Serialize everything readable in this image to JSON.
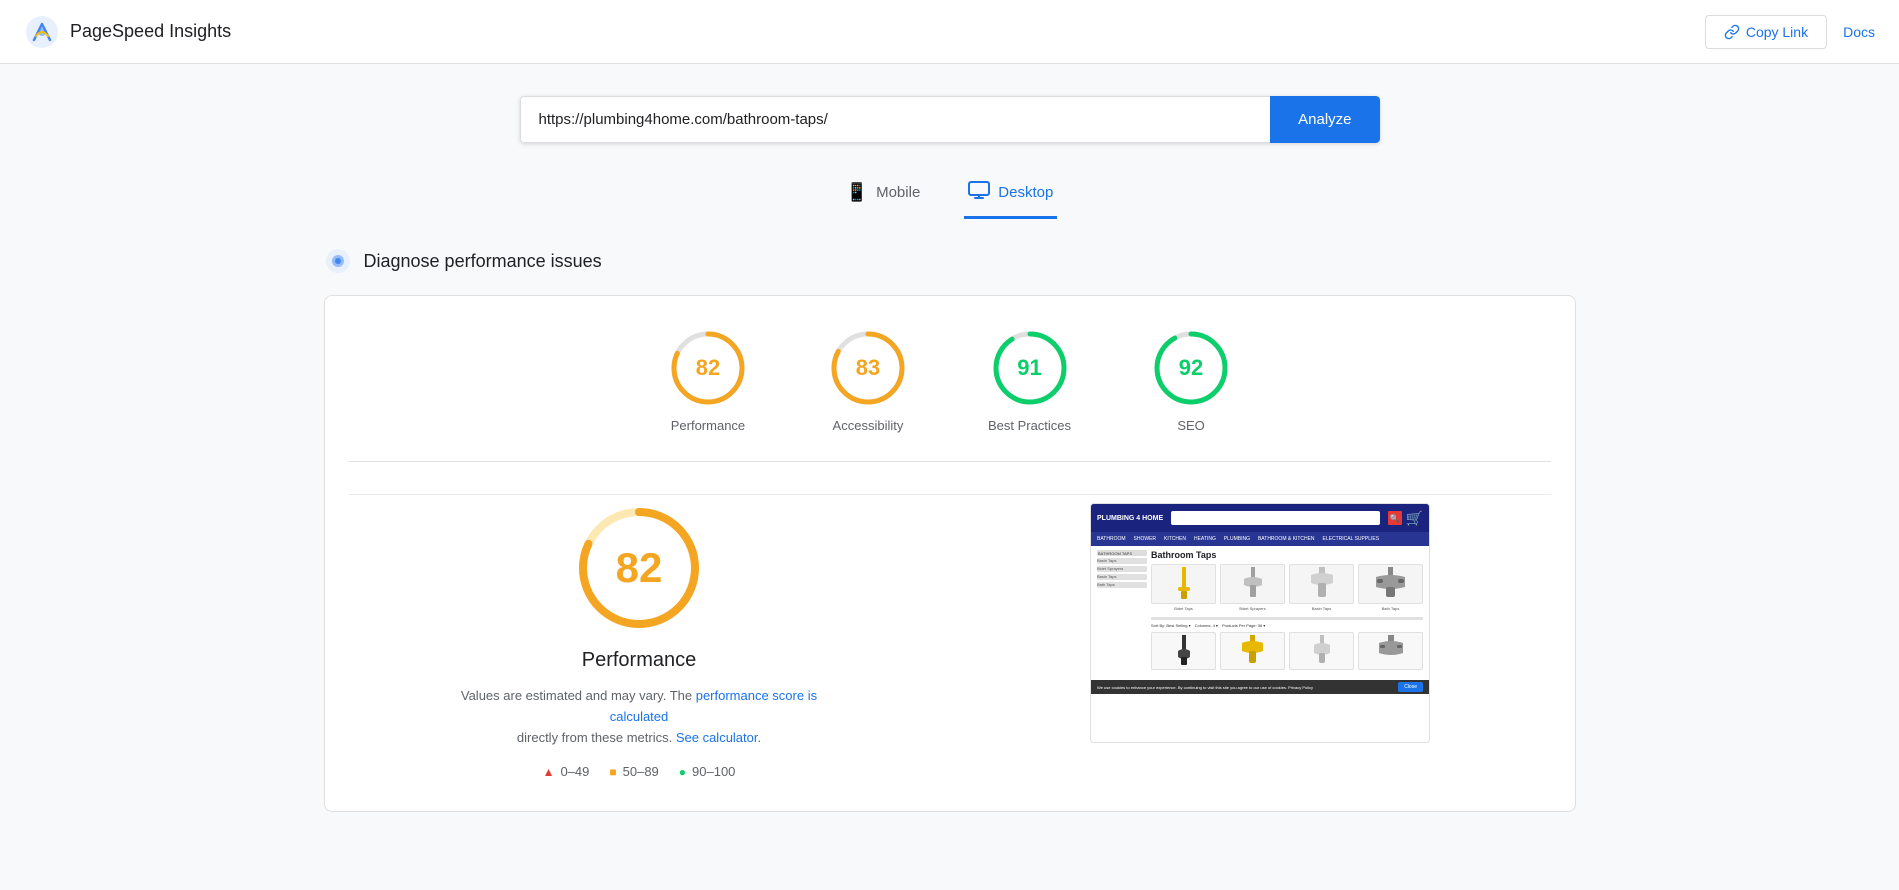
{
  "header": {
    "app_name": "PageSpeed Insights",
    "copy_link_label": "Copy Link",
    "docs_label": "Docs"
  },
  "url_bar": {
    "url_value": "https://plumbing4home.com/bathroom-taps/",
    "analyze_label": "Analyze"
  },
  "tabs": [
    {
      "id": "mobile",
      "label": "Mobile",
      "active": false
    },
    {
      "id": "desktop",
      "label": "Desktop",
      "active": true
    }
  ],
  "section": {
    "title": "Diagnose performance issues"
  },
  "scores": [
    {
      "id": "performance",
      "value": 82,
      "label": "Performance",
      "color": "#f4a522",
      "bg_color": "#fce8b2",
      "pct": 82
    },
    {
      "id": "accessibility",
      "value": 83,
      "label": "Accessibility",
      "color": "#f4a522",
      "bg_color": "#fce8b2",
      "pct": 83
    },
    {
      "id": "best-practices",
      "value": 91,
      "label": "Best Practices",
      "color": "#0cce6b",
      "bg_color": "#c8f5d5",
      "pct": 91
    },
    {
      "id": "seo",
      "value": 92,
      "label": "SEO",
      "color": "#0cce6b",
      "bg_color": "#c8f5d5",
      "pct": 92
    }
  ],
  "detail": {
    "big_score": 82,
    "big_label": "Performance",
    "metrics_note_text": "Values are estimated and may vary. The",
    "metrics_note_link1": "performance score is calculated",
    "metrics_note_mid": "directly from these metrics.",
    "metrics_note_link2": "See calculator.",
    "legend": [
      {
        "icon": "▲",
        "color": "#e53935",
        "range": "0–49"
      },
      {
        "icon": "■",
        "color": "#f4a522",
        "range": "50–89"
      },
      {
        "icon": "●",
        "color": "#0cce6b",
        "range": "90–100"
      }
    ]
  }
}
